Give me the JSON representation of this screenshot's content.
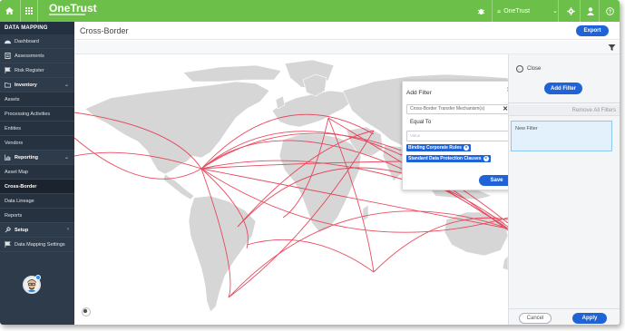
{
  "app": {
    "logo": "OneTrust"
  },
  "topbar": {
    "org_name": "OneTrust"
  },
  "sidebar": {
    "title": "DATA MAPPING",
    "items": [
      {
        "label": "Dashboard",
        "icon": "dashboard-icon"
      },
      {
        "label": "Assessments",
        "icon": "assessments-icon"
      },
      {
        "label": "Risk Register",
        "icon": "flag-icon"
      },
      {
        "label": "Inventory",
        "icon": "folder-icon"
      },
      {
        "label": "Assets"
      },
      {
        "label": "Processing Activities"
      },
      {
        "label": "Entities"
      },
      {
        "label": "Vendors"
      },
      {
        "label": "Reporting",
        "icon": "chart-icon"
      },
      {
        "label": "Asset Map"
      },
      {
        "label": "Cross-Border"
      },
      {
        "label": "Data Lineage"
      },
      {
        "label": "Reports"
      },
      {
        "label": "Setup",
        "icon": "wrench-icon"
      },
      {
        "label": "Data Mapping Settings",
        "icon": "flag-icon"
      }
    ]
  },
  "header": {
    "title": "Cross-Border",
    "export_label": "Export"
  },
  "filter_popup": {
    "title": "Add Filter",
    "field_value": "Cross-Border Transfer Mechanism(s)",
    "operator_label": "Equal To",
    "value_placeholder": "Value",
    "tags": [
      "Binding Corporate Rules",
      "Standard Data Protection Clauses"
    ],
    "save_label": "Save"
  },
  "right_panel": {
    "close_label": "Close",
    "add_filter_label": "Add Filter",
    "remove_all_label": "Remove All Filters",
    "new_filter_label": "New Filter",
    "cancel_label": "Cancel",
    "apply_label": "Apply"
  },
  "colors": {
    "brand_green": "#6cc04a",
    "sidebar_bg": "#2d3b4b",
    "primary_blue": "#1f63d6",
    "flow_line": "#e8384f",
    "land": "#d6d6d6"
  }
}
